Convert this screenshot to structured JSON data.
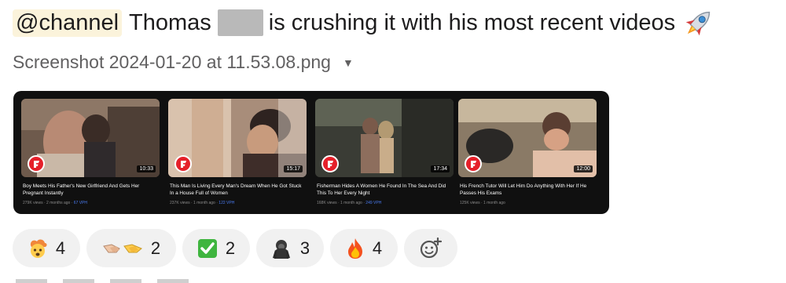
{
  "message": {
    "mention": "@channel",
    "name": "Thomas",
    "text": "is crushing it with his most recent videos",
    "trailing_emoji": "rocket-icon"
  },
  "attachment": {
    "filename": "Screenshot 2024-01-20 at 11.53.08.png"
  },
  "videos": [
    {
      "title": "Boy Meets His Father's New Girlfriend And Gets Her Pregnant Instantly",
      "duration": "10:33",
      "views": "279K views",
      "age": "2 months ago",
      "vph": "67 VPH"
    },
    {
      "title": "This Man Is Living Every Man's Dream When He Got Stuck In a House Full of Women",
      "duration": "15:17",
      "views": "237K views",
      "age": "1 month ago",
      "vph": "122 VPH"
    },
    {
      "title": "Fisherman Hides A Women He Found In The Sea And Did This To Her Every Night",
      "duration": "17:34",
      "views": "168K views",
      "age": "1 month ago",
      "vph": "249 VPH"
    },
    {
      "title": "His French Tutor Will Let Him Do Anything With Her If He Passes His Exams",
      "duration": "12:00",
      "views": "125K views",
      "age": "1 month ago",
      "vph": ""
    }
  ],
  "reactions": [
    {
      "emoji": "exploding-head-icon",
      "count": "4"
    },
    {
      "emoji": "handshake-icon",
      "count": "2"
    },
    {
      "emoji": "check-mark-button-icon",
      "count": "2"
    },
    {
      "emoji": "gorilla-icon",
      "count": "3"
    },
    {
      "emoji": "fire-icon",
      "count": "4"
    }
  ],
  "colors": {
    "mention_bg": "#fbf3db",
    "video_bg": "#101010",
    "pill_bg": "#f1f1f1",
    "vph": "#4a7cf3",
    "channel_logo": "#e5202a"
  }
}
